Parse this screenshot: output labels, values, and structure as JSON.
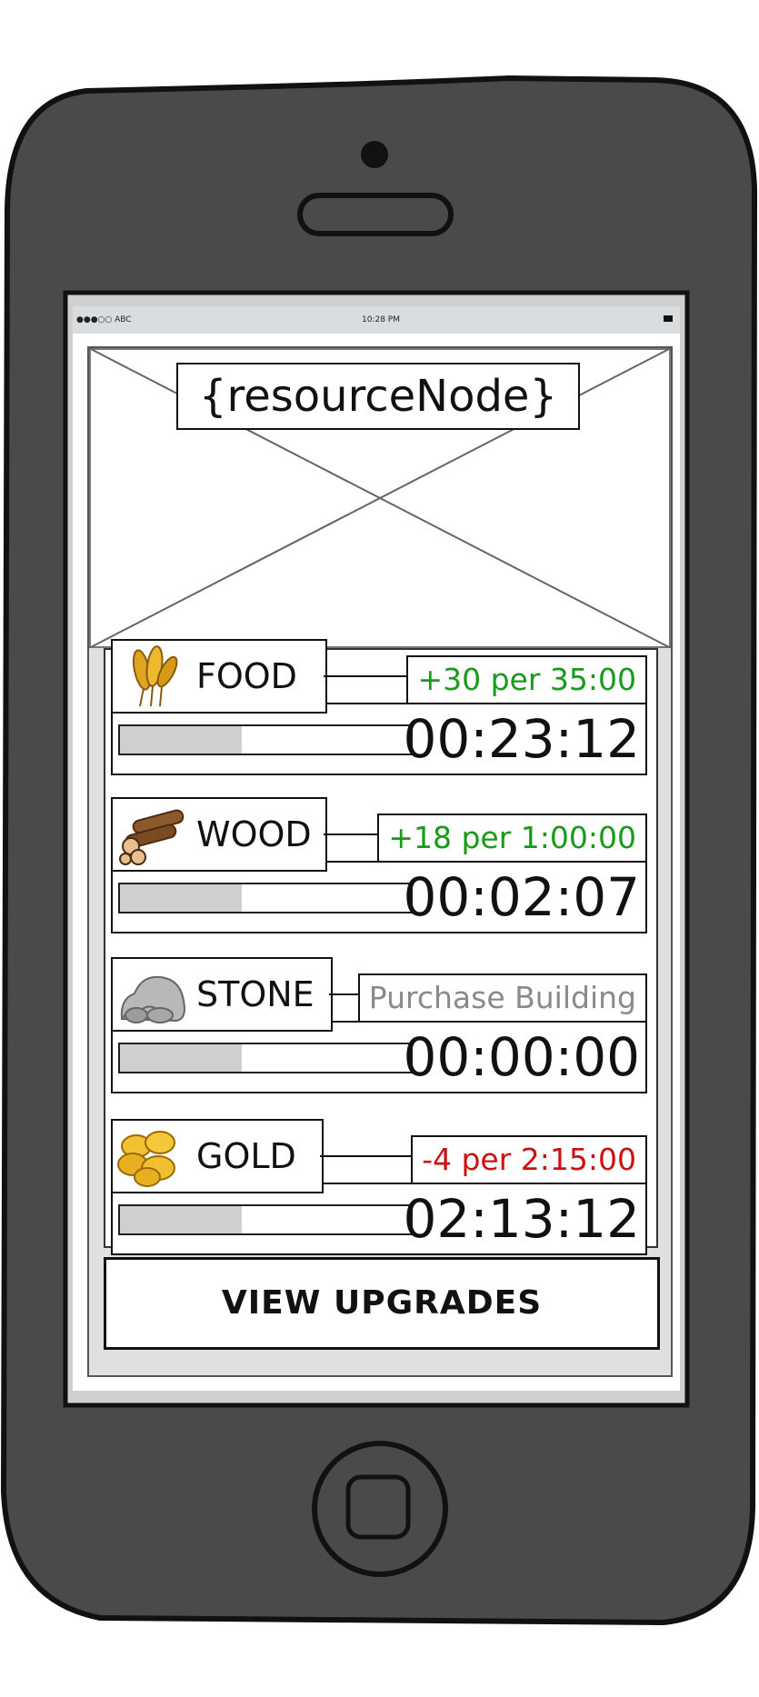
{
  "status_bar": {
    "carrier": "●●●○○ ABC",
    "time": "10:28 PM"
  },
  "hero": {
    "title": "{resourceNode}"
  },
  "resources": [
    {
      "name": "FOOD",
      "icon": "wheat-icon",
      "rate": "+30 per 35:00",
      "rate_color": "#1a9a1a",
      "timer": "00:23:12",
      "progress": 0.42
    },
    {
      "name": "WOOD",
      "icon": "logs-icon",
      "rate": "+18 per 1:00:00",
      "rate_color": "#1a9a1a",
      "timer": "00:02:07",
      "progress": 0.42
    },
    {
      "name": "STONE",
      "icon": "rock-icon",
      "rate": "Purchase Building",
      "rate_color": "#8a8a8a",
      "timer": "00:00:00",
      "progress": 0.42
    },
    {
      "name": "GOLD",
      "icon": "coins-icon",
      "rate": "-4 per 2:15:00",
      "rate_color": "#cc1111",
      "timer": "02:13:12",
      "progress": 0.42
    }
  ],
  "actions": {
    "view_upgrades": "VIEW UPGRADES"
  },
  "colors": {
    "phone_body": "#4a4a4a",
    "status_bar_bg": "#d8dde0",
    "progress_fill": "#cfcfcf"
  }
}
